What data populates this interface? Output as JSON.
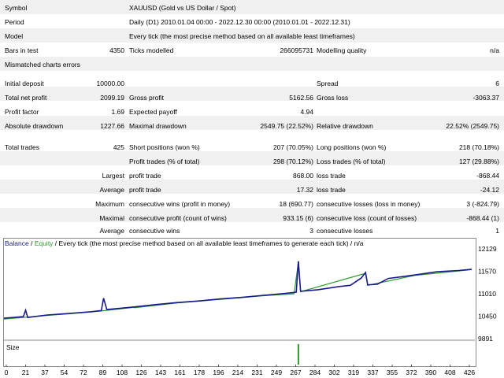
{
  "report": {
    "symbol_label": "Symbol",
    "symbol_value": "XAUUSD (Gold vs US Dollar / Spot)",
    "period_label": "Period",
    "period_value": "Daily (D1) 2010.01.04 00:00 - 2022.12.30 00:00 (2010.01.01 - 2022.12.31)",
    "model_label": "Model",
    "model_value": "Every tick (the most precise method based on all available least timeframes)",
    "bars_label": "Bars in test",
    "bars_value": "4350",
    "ticks_label": "Ticks modelled",
    "ticks_value": "266095731",
    "quality_label": "Modelling quality",
    "quality_value": "n/a",
    "mismatch_label": "Mismatched charts errors",
    "deposit_label": "Initial deposit",
    "deposit_value": "10000.00",
    "spread_label": "Spread",
    "spread_value": "6",
    "net_label": "Total net profit",
    "net_value": "2099.19",
    "gross_profit_label": "Gross profit",
    "gross_profit_value": "5162.56",
    "gross_loss_label": "Gross loss",
    "gross_loss_value": "-3063.37",
    "pf_label": "Profit factor",
    "pf_value": "1.69",
    "payoff_label": "Expected payoff",
    "payoff_value": "4.94",
    "abs_dd_label": "Absolute drawdown",
    "abs_dd_value": "1227.66",
    "max_dd_label": "Maximal drawdown",
    "max_dd_value": "2549.75 (22.52%)",
    "rel_dd_label": "Relative drawdown",
    "rel_dd_value": "22.52% (2549.75)",
    "trades_label": "Total trades",
    "trades_value": "425",
    "short_label": "Short positions (won %)",
    "short_value": "207 (70.05%)",
    "long_label": "Long positions (won %)",
    "long_value": "218 (70.18%)",
    "profit_trades_label": "Profit trades (% of total)",
    "profit_trades_value": "298 (70.12%)",
    "loss_trades_label": "Loss trades (% of total)",
    "loss_trades_value": "127 (29.88%)",
    "largest_label": "Largest",
    "largest_profit_label": "profit trade",
    "largest_profit_value": "868.00",
    "largest_loss_label": "loss trade",
    "largest_loss_value": "-868.44",
    "average_label": "Average",
    "average_profit_label": "profit trade",
    "average_profit_value": "17.32",
    "average_loss_label": "loss trade",
    "average_loss_value": "-24.12",
    "maximum_label": "Maximum",
    "max_wins_label": "consecutive wins (profit in money)",
    "max_wins_value": "18 (690.77)",
    "max_losses_label": "consecutive losses (loss in money)",
    "max_losses_value": "3 (-824.79)",
    "maximal_label": "Maximal",
    "maximal_profit_label": "consecutive profit (count of wins)",
    "maximal_profit_value": "933.15 (6)",
    "maximal_loss_label": "consecutive loss (count of losses)",
    "maximal_loss_value": "-868.44 (1)",
    "average2_label": "Average",
    "avg_wins_label": "consecutive wins",
    "avg_wins_value": "3",
    "avg_losses_label": "consecutive losses",
    "avg_losses_value": "1"
  },
  "chart_title": {
    "balance": "Balance",
    "sep": " / ",
    "equity": "Equity",
    "rest": " / Every tick (the most precise method based on all available least timeframes to generate each tick) / n/a"
  },
  "size_label": "Size",
  "colors": {
    "balance": "#1a1a8c",
    "equity": "#2e9a2e",
    "frame": "#8a8a8a"
  },
  "chart_data": {
    "type": "line",
    "title": "",
    "xlabel": "",
    "ylabel": "",
    "x_ticks": [
      "0",
      "21",
      "37",
      "54",
      "72",
      "89",
      "108",
      "126",
      "143",
      "161",
      "178",
      "196",
      "214",
      "231",
      "249",
      "267",
      "284",
      "302",
      "319",
      "337",
      "355",
      "372",
      "390",
      "408",
      "426"
    ],
    "y_ticks": [
      "12129",
      "11570",
      "11010",
      "10450",
      "9891"
    ],
    "ylim": [
      9891,
      12129
    ],
    "xlim": [
      0,
      435
    ],
    "series": [
      {
        "name": "Balance",
        "points": [
          [
            0,
            10400
          ],
          [
            18,
            10440
          ],
          [
            20,
            10600
          ],
          [
            22,
            10420
          ],
          [
            40,
            10480
          ],
          [
            60,
            10520
          ],
          [
            80,
            10560
          ],
          [
            90,
            10590
          ],
          [
            92,
            10900
          ],
          [
            95,
            10620
          ],
          [
            100,
            10630
          ],
          [
            120,
            10680
          ],
          [
            140,
            10740
          ],
          [
            160,
            10790
          ],
          [
            180,
            10830
          ],
          [
            200,
            10880
          ],
          [
            220,
            10920
          ],
          [
            240,
            10970
          ],
          [
            260,
            11020
          ],
          [
            270,
            11050
          ],
          [
            272,
            11820
          ],
          [
            274,
            11070
          ],
          [
            290,
            11110
          ],
          [
            310,
            11190
          ],
          [
            320,
            11220
          ],
          [
            330,
            11400
          ],
          [
            334,
            11540
          ],
          [
            336,
            11230
          ],
          [
            345,
            11250
          ],
          [
            355,
            11390
          ],
          [
            380,
            11480
          ],
          [
            400,
            11560
          ],
          [
            420,
            11590
          ],
          [
            432,
            11620
          ]
        ]
      },
      {
        "name": "Equity",
        "points": [
          [
            0,
            10380
          ],
          [
            18,
            10420
          ],
          [
            40,
            10470
          ],
          [
            60,
            10510
          ],
          [
            90,
            10580
          ],
          [
            120,
            10670
          ],
          [
            121,
            10660
          ],
          [
            160,
            10780
          ],
          [
            200,
            10870
          ],
          [
            240,
            10960
          ],
          [
            268,
            11010
          ],
          [
            272,
            11800
          ],
          [
            274,
            11060
          ],
          [
            334,
            11520
          ],
          [
            336,
            11220
          ],
          [
            380,
            11470
          ],
          [
            432,
            11610
          ]
        ]
      }
    ],
    "size_bars": [
      {
        "x": 272,
        "value": 1
      }
    ]
  }
}
